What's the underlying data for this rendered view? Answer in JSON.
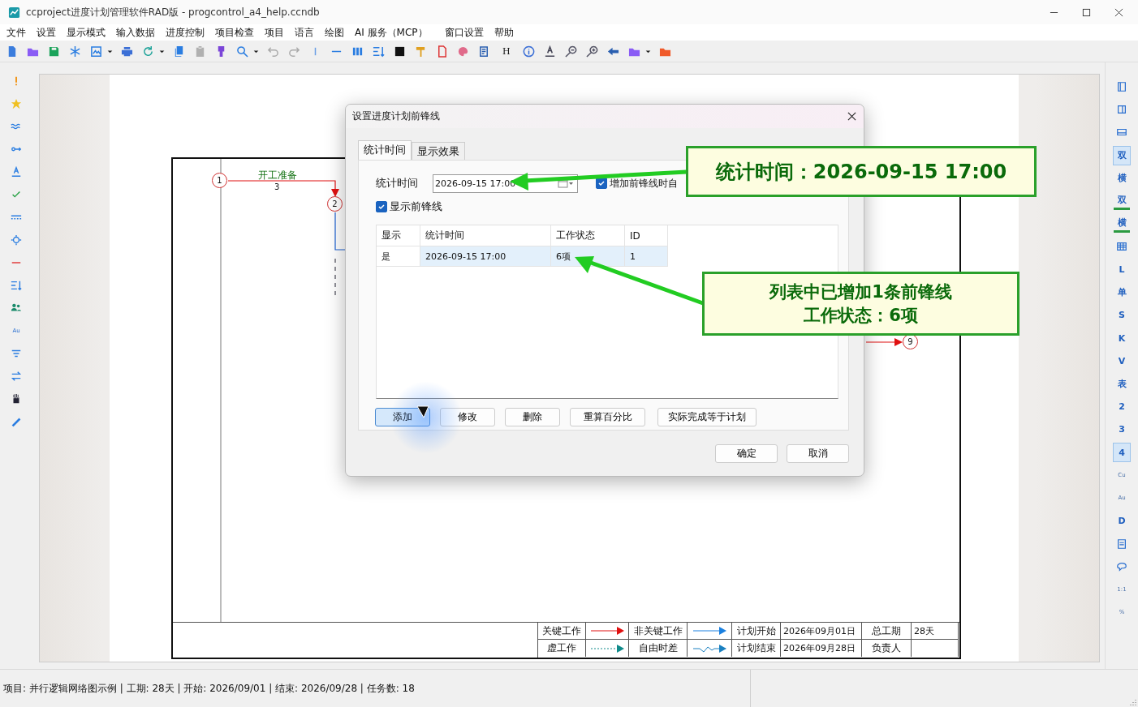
{
  "window": {
    "title": "ccproject进度计划管理软件RAD版 - progcontrol_a4_help.ccndb"
  },
  "menu": [
    "文件",
    "设置",
    "显示模式",
    "输入数据",
    "进度控制",
    "项目检查",
    "项目",
    "语言",
    "绘图",
    "AI 服务（MCP）",
    "窗口设置",
    "帮助"
  ],
  "toolbar": {
    "text_button": "H"
  },
  "left_toolbar": {
    "text_button": "Au"
  },
  "right_toolbar": [
    {
      "kind": "icon",
      "selected": false
    },
    {
      "kind": "icon",
      "selected": false
    },
    {
      "kind": "icon",
      "selected": false
    },
    {
      "kind": "text",
      "label": "双",
      "selected": true
    },
    {
      "kind": "text",
      "label": "横",
      "selected": false
    },
    {
      "kind": "badge",
      "label": "双",
      "selected": false
    },
    {
      "kind": "badge",
      "label": "横",
      "selected": false
    },
    {
      "kind": "icon",
      "selected": false
    },
    {
      "kind": "text",
      "label": "L",
      "selected": false
    },
    {
      "kind": "text",
      "label": "单",
      "selected": false
    },
    {
      "kind": "text",
      "label": "S",
      "selected": false
    },
    {
      "kind": "text",
      "label": "K",
      "selected": false
    },
    {
      "kind": "text",
      "label": "V",
      "selected": false
    },
    {
      "kind": "text",
      "label": "表",
      "selected": false
    },
    {
      "kind": "text",
      "label": "2",
      "selected": false
    },
    {
      "kind": "text",
      "label": "3",
      "selected": false
    },
    {
      "kind": "text",
      "label": "4",
      "selected": true
    },
    {
      "kind": "small",
      "label": "Cu",
      "selected": false
    },
    {
      "kind": "small",
      "label": "Au",
      "selected": false
    },
    {
      "kind": "text",
      "label": "D",
      "selected": false
    },
    {
      "kind": "icon",
      "selected": false
    },
    {
      "kind": "icon",
      "selected": false
    },
    {
      "kind": "small",
      "label": "1:1",
      "selected": false
    },
    {
      "kind": "small",
      "label": "%",
      "selected": false
    }
  ],
  "diagram": {
    "nodes": [
      "1",
      "2",
      "9"
    ],
    "task": {
      "name": "开工准备",
      "duration": "3"
    },
    "legend": {
      "items": [
        {
          "label": "关键工作",
          "kind": "critical"
        },
        {
          "label": "非关键工作",
          "kind": "normal"
        },
        {
          "label": "虚工作",
          "kind": "dummy"
        },
        {
          "label": "自由时差",
          "kind": "float"
        }
      ],
      "info": [
        {
          "label": "计划开始",
          "value": "2026年09月01日"
        },
        {
          "label": "总工期",
          "value": "28天"
        },
        {
          "label": "计划结束",
          "value": "2026年09月28日"
        },
        {
          "label": "负责人"
        }
      ]
    }
  },
  "dialog": {
    "title": "设置进度计划前锋线",
    "tabs": [
      {
        "label": "统计时间",
        "selected": true
      },
      {
        "label": "显示效果",
        "selected": false
      }
    ],
    "time_label": "统计时间",
    "time_value": "2026-09-15 17:00",
    "auto_calc": {
      "label": "增加前锋线时自",
      "checked": true
    },
    "show_line": {
      "label": "显示前锋线",
      "checked": true
    },
    "table": {
      "columns": [
        "显示",
        "统计时间",
        "工作状态",
        "ID"
      ],
      "rows": [
        {
          "cells": [
            "是",
            "2026-09-15 17:00",
            "6项",
            "1"
          ],
          "selected": true
        }
      ]
    },
    "buttons": [
      {
        "label": "添加",
        "focused": true
      },
      {
        "label": "修改",
        "focused": false
      },
      {
        "label": "删除",
        "focused": false
      },
      {
        "label": "重算百分比",
        "focused": false
      },
      {
        "label": "实际完成等于计划",
        "focused": false
      }
    ],
    "footer_buttons": [
      "确定",
      "取消"
    ]
  },
  "annotations": [
    {
      "lines": [
        "统计时间：2026-09-15 17:00"
      ]
    },
    {
      "lines": [
        "列表中已增加1条前锋线",
        "工作状态：6项"
      ]
    }
  ],
  "status_bar": "项目: 并行逻辑网络图示例 | 工期: 28天 | 开始: 2026/09/01 | 结束: 2026/09/28 | 任务数: 18"
}
